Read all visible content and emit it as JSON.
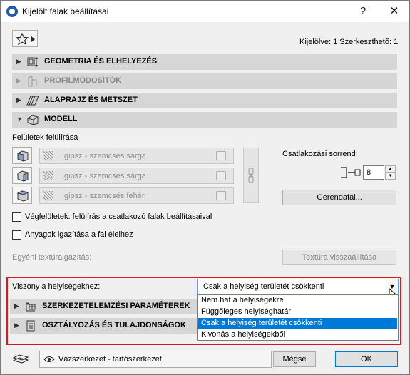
{
  "window": {
    "title": "Kijelölt falak beállításai"
  },
  "titlebar": {
    "help": "?",
    "close": "✕"
  },
  "header": {
    "selection_info": "Kijelölve: 1 Szerkeszthető: 1"
  },
  "sections": {
    "geometry": "GEOMETRIA ÉS ELHELYEZÉS",
    "profile": "PROFILMÓDOSÍTÓK",
    "floorplan": "ALAPRAJZ ÉS METSZET",
    "model": "MODELL",
    "structural": "SZERKEZETELEMZÉSI PARAMÉTEREK",
    "classification": "OSZTÁLYOZÁS ÉS TULAJDONSÁGOK"
  },
  "surfaces": {
    "label": "Felületek felülírása",
    "items": [
      "gipsz - szemcsés sárga",
      "gipsz - szemcsés sárga",
      "gipsz - szemcsés fehér"
    ]
  },
  "connection": {
    "label": "Csatlakozási sorrend:",
    "value": "8",
    "beam_button": "Gerendafal..."
  },
  "checkboxes": {
    "end_surfaces": "Végfelületek: felülírás a csatlakozó falak beállításaival",
    "align_materials": "Anyagok igazítása a fal éleihez"
  },
  "texture": {
    "label": "Egyéni textúraigazítás:",
    "reset_button": "Textúra visszaállítása"
  },
  "zones": {
    "label": "Viszony a helyiségekhez:",
    "selected": "Csak a helyiség területét csökkenti",
    "options": [
      "Nem hat a helyiségekre",
      "Függőleges helyiséghatár",
      "Csak a helyiség területét csökkenti",
      "Kivonás a helyiségekből"
    ]
  },
  "footer": {
    "layer": "Vázszerkezet - tartószerkezet",
    "cancel": "Mégse",
    "ok": "OK"
  }
}
